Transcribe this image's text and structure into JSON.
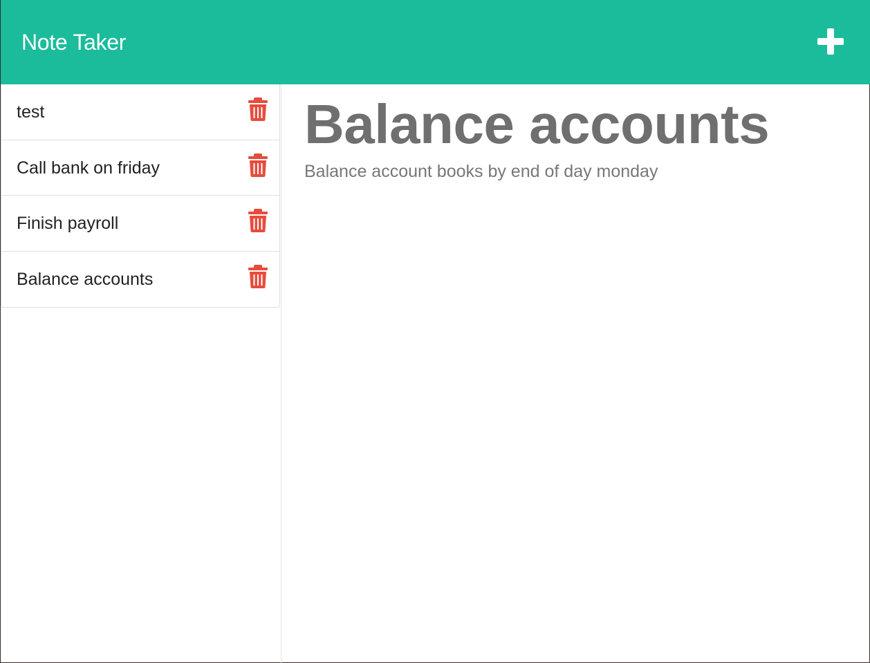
{
  "header": {
    "brand": "Note Taker",
    "new_note_icon": "plus-icon",
    "accent_color": "#1abc9c"
  },
  "sidebar": {
    "notes": [
      {
        "title": "test"
      },
      {
        "title": "Call bank on friday"
      },
      {
        "title": "Finish payroll"
      },
      {
        "title": "Balance accounts"
      }
    ],
    "delete_icon": "trash-icon",
    "delete_color": "#e74c3c"
  },
  "main": {
    "note_title": "Balance accounts",
    "note_text": "Balance account books by end of day monday"
  }
}
